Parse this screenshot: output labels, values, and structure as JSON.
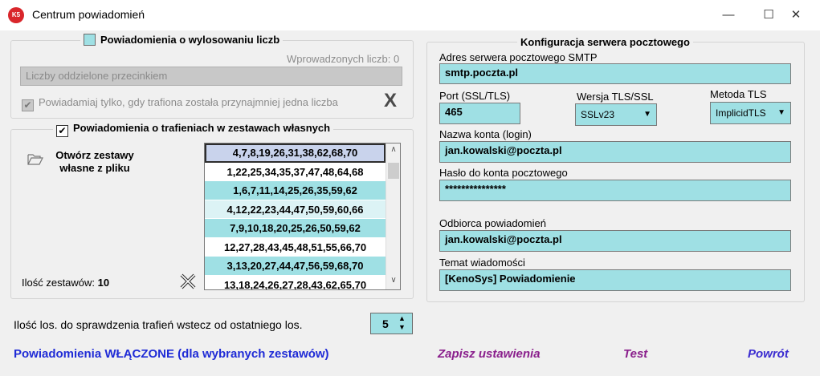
{
  "window": {
    "title": "Centrum powiadomień",
    "logo": "K5",
    "controls": {
      "minimize": "—",
      "maximize": "☐",
      "close": "✕"
    }
  },
  "draw_section": {
    "legend": "Powiadomienia o wylosowaniu liczb",
    "entered_count": "Wprowadzonych liczb: 0",
    "numbers_placeholder": "Liczby oddzielone przecinkiem",
    "notify_only_label": "Powiadamiaj tylko, gdy trafiona została przynajmniej jedna liczba",
    "clear_icon": "X"
  },
  "sets_section": {
    "legend": "Powiadomienia o trafieniach w zestawach własnych",
    "open_label_1": "Otwórz zestawy",
    "open_label_2": "własne z pliku",
    "count_label": "Ilość zestawów:",
    "count_value": "10",
    "sets": [
      "4,7,8,19,26,31,38,62,68,70",
      "1,22,25,34,35,37,47,48,64,68",
      "1,6,7,11,14,25,26,35,59,62",
      "4,12,22,23,44,47,50,59,60,66",
      "7,9,10,18,20,25,26,50,59,62",
      "12,27,28,43,45,48,51,55,66,70",
      "3,13,20,27,44,47,56,59,68,70",
      "13,18,24,26,27,28,43,62,65,70"
    ]
  },
  "back_check": {
    "label": "Ilość los. do sprawdzenia trafień wstecz od ostatniego los.",
    "value": "5"
  },
  "smtp": {
    "legend": "Konfiguracja serwera pocztowego",
    "server_label": "Adres serwera pocztowego SMTP",
    "server_value": "smtp.poczta.pl",
    "port_label": "Port (SSL/TLS)",
    "port_value": "465",
    "tls_version_label": "Wersja TLS/SSL",
    "tls_version_value": "SSLv23",
    "tls_method_label": "Metoda TLS",
    "tls_method_value": "ImplicidTLS",
    "login_label": "Nazwa konta (login)",
    "login_value": "jan.kowalski@poczta.pl",
    "password_label": "Hasło do konta pocztowego",
    "password_value": "***************",
    "recipient_label": "Odbiorca powiadomień",
    "recipient_value": "jan.kowalski@poczta.pl",
    "subject_label": "Temat wiadomości",
    "subject_value": "[KenoSys] Powiadomienie"
  },
  "footer": {
    "status": "Powiadomienia WŁĄCZONE (dla wybranych zestawów)",
    "save": "Zapisz ustawienia",
    "test": "Test",
    "back": "Powrót"
  },
  "colors": {
    "field": "#9fe0e4",
    "status": "#1f2bd6",
    "action": "#8a1f8c",
    "back": "#3a2bd0"
  }
}
